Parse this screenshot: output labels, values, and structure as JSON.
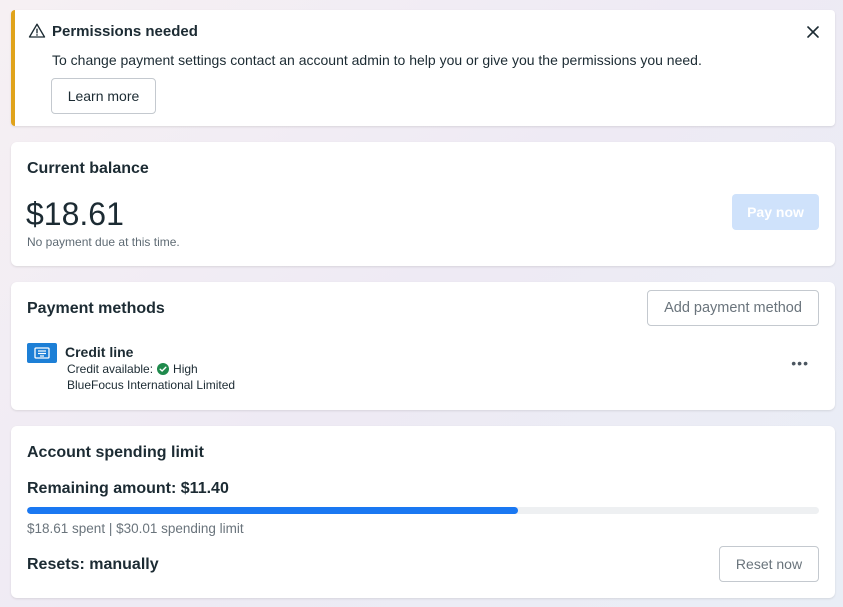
{
  "banner": {
    "icon": "warning-icon",
    "title": "Permissions needed",
    "message": "To change payment settings contact an account admin to help you or give you the permissions you need.",
    "learn_more": "Learn more",
    "accent_color": "#e0a31b"
  },
  "balance": {
    "title": "Current balance",
    "amount": "$18.61",
    "note": "No payment due at this time.",
    "pay_label": "Pay now"
  },
  "methods": {
    "title": "Payment methods",
    "add_label": "Add payment method",
    "item": {
      "icon": "credit-line-icon",
      "name": "Credit line",
      "credit_label": "Credit available:",
      "credit_status": "High",
      "company": "BlueFocus International Limited",
      "more": "•••"
    }
  },
  "limit": {
    "title": "Account spending limit",
    "remaining": "Remaining amount: $11.40",
    "progress": 0.62,
    "spent_text": "$18.61 spent | $30.01 spending limit",
    "resets": "Resets: manually",
    "reset_label": "Reset now",
    "bar_color": "#1a78f2"
  }
}
